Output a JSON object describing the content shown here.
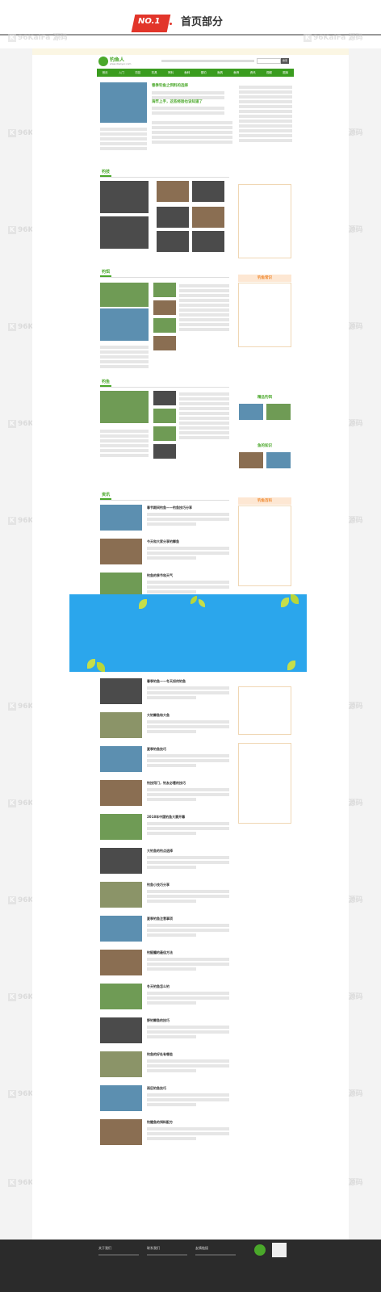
{
  "banner": {
    "badge_no": "NO.1",
    "title": "首页部分"
  },
  "watermark": {
    "brand": "96KaiFa 源码",
    "url": "www.96kaifa.com"
  },
  "header": {
    "logo_text": "钓鱼人",
    "logo_sub": "www.diaoyur.com",
    "search_button": "搜索"
  },
  "nav": {
    "items": [
      "首页",
      "入门",
      "钓技",
      "钓具",
      "饵料",
      "鱼种",
      "垂钓",
      "渔具",
      "鱼饵",
      "资讯",
      "视频",
      "图库"
    ]
  },
  "main": {
    "headline1": "春季钓鱼之饵料的选择",
    "headline2": "海竿上手，这些经验也该知道了",
    "sec1_tab": "钓技",
    "sec2_tab": "钓饵",
    "sec3_tab": "钓鱼",
    "sec4_tab": "资讯"
  },
  "sidebar": {
    "box1_title": "钓鱼常识",
    "box2_title": "精品钓饵",
    "box3_title": "鱼的知识",
    "box4_title": "钓鱼百科"
  },
  "articles": [
    "春节期间钓鱼——钓鱼技巧分享",
    "今天和大家分享钓鲫鱼",
    "钓鱼的季节和天气",
    "春季钓鱼——冬天如何钓鱼",
    "大钓鲫鱼和大鱼",
    "夏季钓鱼技巧",
    "钓技窍门，钓友必看的技巧",
    "2018年中国钓鱼大赛开幕",
    "大钓鱼的钓点选择",
    "钓鱼小技巧分享",
    "夏季钓鱼注意事项",
    "钓鲢鳙的最佳方法",
    "冬天钓鱼怎么钓",
    "野钓鲫鱼的技巧",
    "钓鱼的好处有哪些",
    "雨后钓鱼技巧",
    "钓鲤鱼的饵料配方"
  ],
  "footer": {
    "col1": "关于我们",
    "col2": "联系我们",
    "col3": "友情链接"
  },
  "colors": {
    "accent": "#4aa82a",
    "orange": "#f08a31"
  }
}
